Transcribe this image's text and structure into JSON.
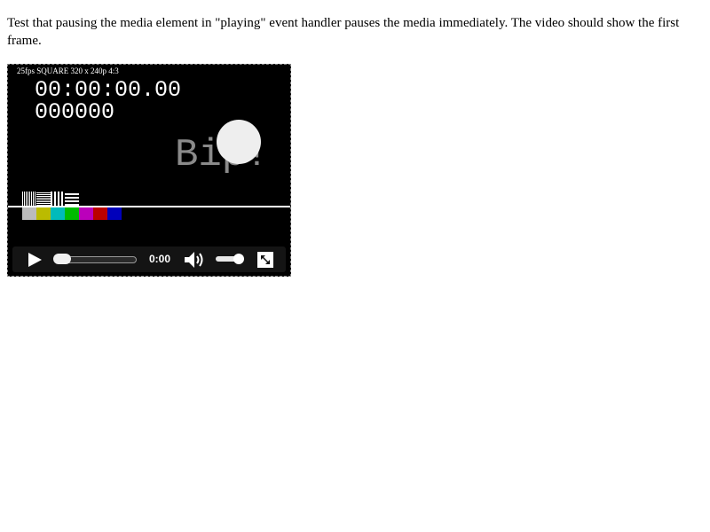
{
  "description": "Test that pausing the media element in \"playing\" event handler pauses the media immediately. The video should show the first frame.",
  "video": {
    "info_text": "25fps SQUARE 320 x 240p 4:3",
    "timecode": "00:00:00.00",
    "frame_counter": "000000",
    "bip_text": "Bip!",
    "color_bars": [
      "#bbbbbb",
      "#bbbb00",
      "#00bbbb",
      "#00bb00",
      "#bb00bb",
      "#bb0000",
      "#0000bb"
    ]
  },
  "controls": {
    "play_icon": "play-icon",
    "current_time": "0:00",
    "seek_position": 0,
    "volume_icon": "volume-icon",
    "volume_level": 1,
    "fullscreen_icon": "fullscreen-icon"
  }
}
